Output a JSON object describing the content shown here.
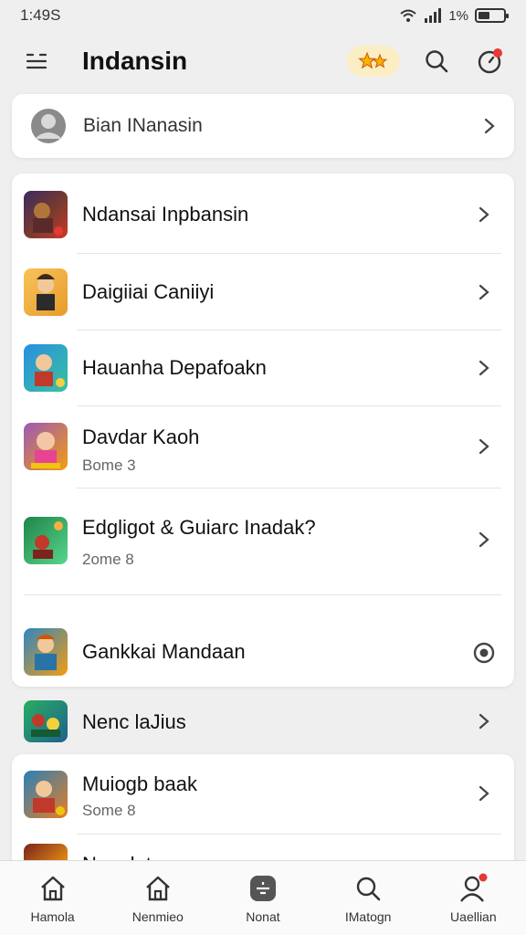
{
  "status_bar": {
    "time": "1:49S",
    "battery_pct": "1%"
  },
  "header": {
    "title": "Indansin"
  },
  "profile": {
    "label": "Bian INanasin"
  },
  "list": [
    {
      "name": "Ndansai Inpbansin",
      "sub": ""
    },
    {
      "name": "Daigiiai Caniiyi",
      "sub": ""
    },
    {
      "name": "Hauanha Depafoakn",
      "sub": ""
    },
    {
      "name": "Davdar Kaoh",
      "sub": "Bome 3"
    },
    {
      "name": "Edgligot & Guiarc Inadak?",
      "sub": "2ome 8"
    },
    {
      "name": "Gankkai Mandaan",
      "sub": ""
    },
    {
      "name": "Nenc laJius",
      "sub": ""
    },
    {
      "name": "Muiogb baak",
      "sub": "Some 8"
    },
    {
      "name": "Nanalat",
      "sub": ""
    }
  ],
  "bottom_nav": [
    {
      "label": "Hamola",
      "icon": "home-icon"
    },
    {
      "label": "Nenmieo",
      "icon": "home-outline-icon"
    },
    {
      "label": "Nonat",
      "icon": "app-icon"
    },
    {
      "label": "IMatogn",
      "icon": "search-icon"
    },
    {
      "label": "Uaellian",
      "icon": "profile-icon"
    }
  ],
  "colors": {
    "accent_red": "#e53935",
    "stars_bg": "#fbeec4",
    "star_gold": "#f4b400"
  }
}
